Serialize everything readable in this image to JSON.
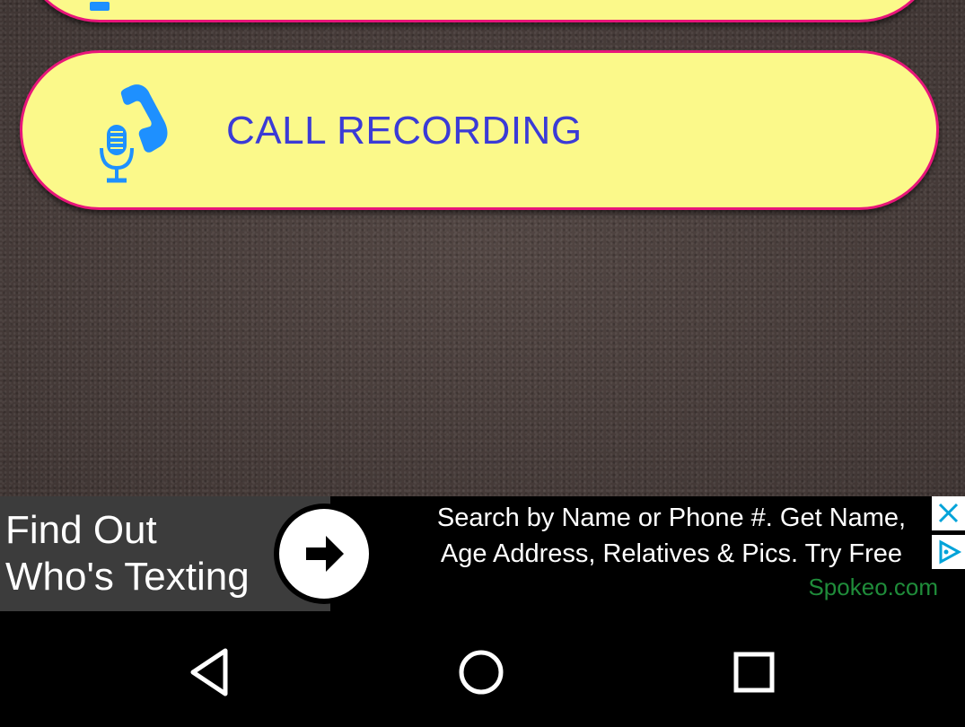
{
  "menu": {
    "call_recording_label": "CALL RECORDING"
  },
  "ad": {
    "headline_line1": "Find Out",
    "headline_line2": "Who's Texting",
    "body_line1": "Search by Name or Phone #. Get Name,",
    "body_line2": "Age Address, Relatives & Pics. Try Free",
    "domain": "Spokeo.com"
  },
  "colors": {
    "button_fill": "#fbf98a",
    "button_border": "#e8167a",
    "label_text": "#3b3bd6",
    "icon_blue": "#1e90ff"
  },
  "icons": {
    "call_recording": "microphone-phone-icon",
    "ad_arrow": "arrow-right-icon",
    "ad_close": "close-icon",
    "ad_choices": "adchoices-icon",
    "nav_back": "back-triangle-icon",
    "nav_home": "home-circle-icon",
    "nav_recent": "recent-apps-square-icon"
  }
}
